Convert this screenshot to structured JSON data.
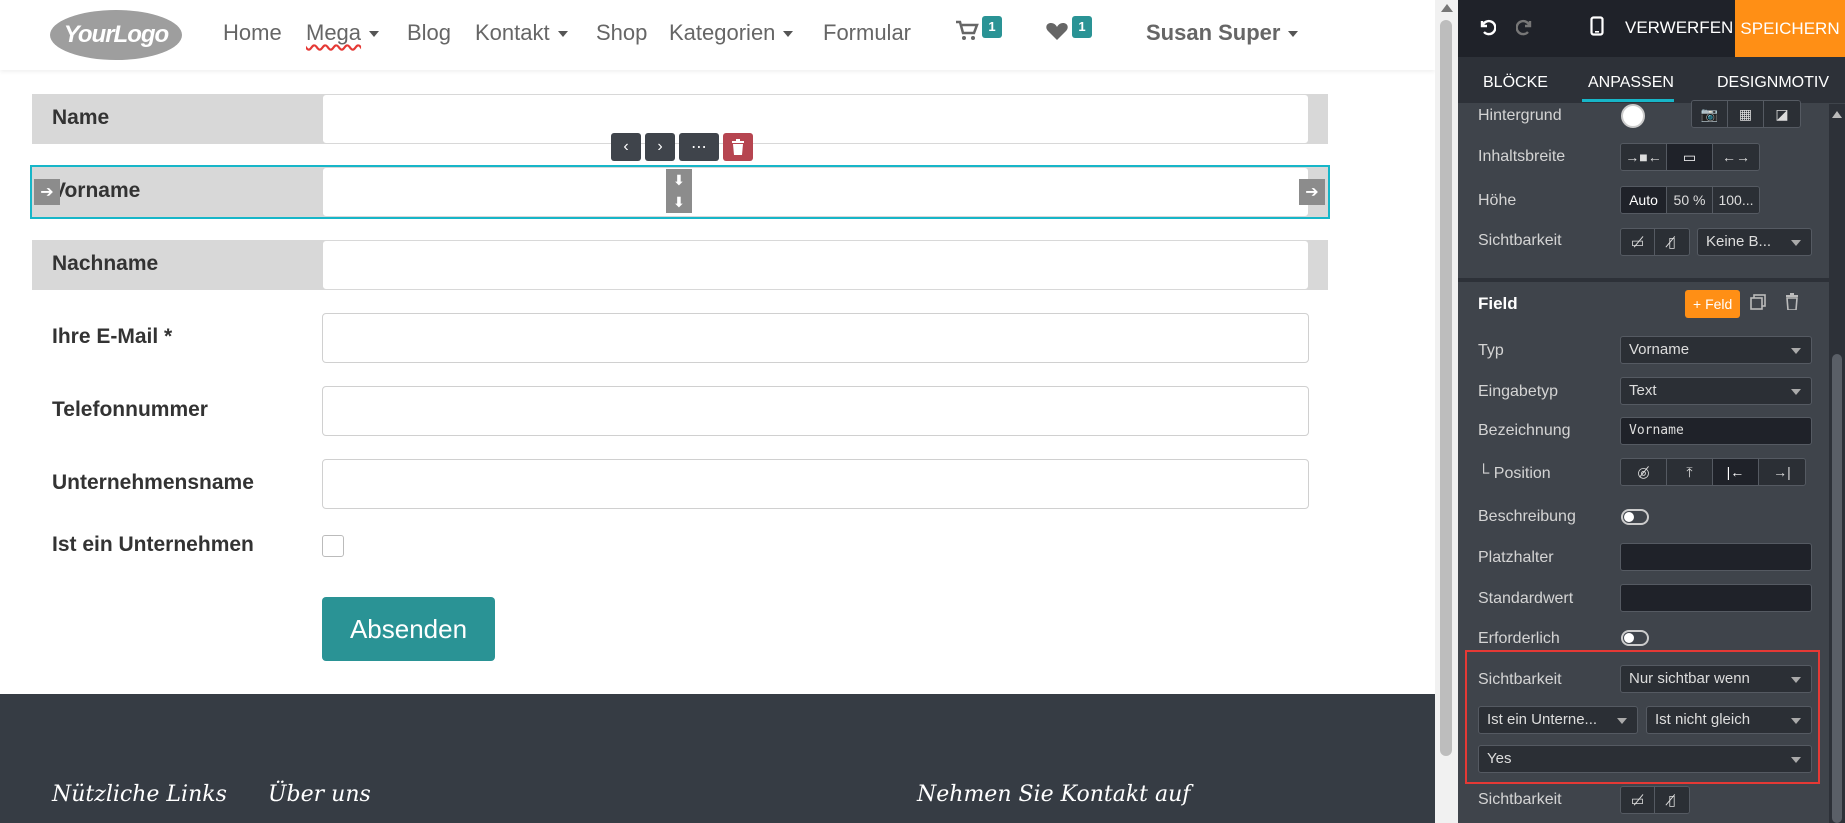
{
  "site": {
    "logo_text": "YourLogo",
    "nav": {
      "items": [
        {
          "label": "Home",
          "has_caret": false
        },
        {
          "label": "Mega",
          "has_caret": true
        },
        {
          "label": "Blog",
          "has_caret": false
        },
        {
          "label": "Kontakt",
          "has_caret": true
        },
        {
          "label": "Shop",
          "has_caret": false
        },
        {
          "label": "Kategorien",
          "has_caret": true
        },
        {
          "label": "Formular",
          "has_caret": false
        }
      ],
      "cart_icon": "shopping-cart-icon",
      "cart_count": "1",
      "wishlist_icon": "heart-icon",
      "wishlist_count": "1",
      "user_name": "Susan Super"
    },
    "form": {
      "fields": [
        {
          "label": "Name",
          "style": "gray"
        },
        {
          "label": "Vorname",
          "style": "gray-selected"
        },
        {
          "label": "Nachname",
          "style": "gray"
        },
        {
          "label": "Ihre E-Mail *",
          "style": "plain"
        },
        {
          "label": "Telefonnummer",
          "style": "plain"
        },
        {
          "label": "Unternehmensname",
          "style": "plain"
        }
      ],
      "checkbox_label": "Ist ein Unternehmen",
      "submit_label": "Absenden"
    },
    "footer": {
      "headings": [
        "Nützliche Links",
        "Über uns",
        "Nehmen Sie Kontakt auf"
      ]
    }
  },
  "editor": {
    "topbar": {
      "undo_icon": "undo-icon",
      "redo_icon": "redo-icon",
      "mobile_icon": "mobile-preview-icon",
      "discard_label": "VERWERFEN",
      "save_label": "SPEICHERN"
    },
    "tabs": [
      "BLÖCKE",
      "ANPASSEN",
      "DESIGNMOTIV"
    ],
    "active_tab": "ANPASSEN",
    "block_options": {
      "background_label": "Hintergrund",
      "content_width_label": "Inhaltsbreite",
      "height_label": "Höhe",
      "height_options": [
        "Auto",
        "50 %",
        "100..."
      ],
      "visibility_label": "Sichtbarkeit",
      "visibility_select": "Keine B..."
    },
    "field": {
      "title": "Field",
      "add_field_label": "+ Feld",
      "type_label": "Typ",
      "type_value": "Vorname",
      "input_type_label": "Eingabetyp",
      "input_type_value": "Text",
      "designation_label": "Bezeichnung",
      "designation_value": "Vorname",
      "position_label": "└ Position",
      "description_label": "Beschreibung",
      "placeholder_label": "Platzhalter",
      "default_value_label": "Standardwert",
      "required_label": "Erforderlich",
      "visibility_label": "Sichtbarkeit",
      "visibility_value": "Nur sichtbar wenn",
      "condition_field": "Ist ein Unterne...",
      "condition_operator": "Ist nicht gleich",
      "condition_value": "Yes",
      "visibility2_label": "Sichtbarkeit"
    },
    "colors": {
      "accent": "#ff8f15",
      "teal": "#17b6c8",
      "highlight": "#e53935"
    }
  }
}
